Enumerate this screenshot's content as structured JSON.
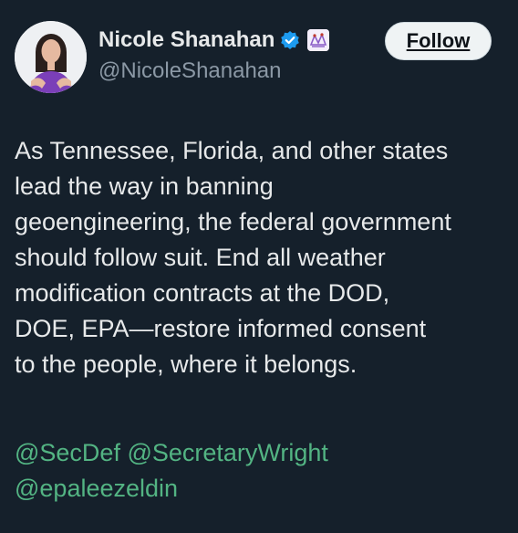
{
  "author": {
    "display_name": "Nicole Shanahan",
    "handle": "@NicoleShanahan",
    "verified_icon": "verified-badge-icon",
    "affiliate_icon": "affiliate-badge-icon"
  },
  "follow_button": {
    "label": "Follow"
  },
  "tweet": {
    "text": "As Tennessee, Florida, and other states\nlead the way in banning\ngeoengineering, the federal government\nshould follow suit. End all weather\nmodification contracts at the DOD,\nDOE, EPA—restore informed consent\nto the people, where it belongs.",
    "mentions": [
      "@SecDef",
      "@SecretaryWright",
      "@epaleezeldin"
    ]
  },
  "colors": {
    "background": "#15202b",
    "text": "#e7e9ea",
    "secondary_text": "#8b98a5",
    "mention": "#53b483",
    "verified": "#1d9bf0"
  }
}
